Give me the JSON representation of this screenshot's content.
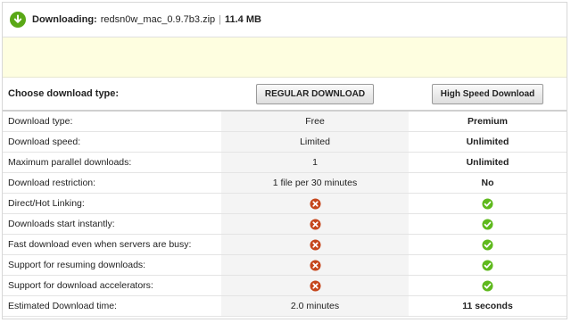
{
  "header": {
    "downloading_label": "Downloading:",
    "filename": "redsn0w_mac_0.9.7b3.zip",
    "separator": "|",
    "size": "11.4 MB",
    "icon": "download-arrow-icon"
  },
  "choose": {
    "label": "Choose download type:",
    "regular_button": "REGULAR DOWNLOAD",
    "premium_button": "High Speed Download"
  },
  "rows": [
    {
      "label": "Download type:",
      "regular": "Free",
      "premium": "Premium"
    },
    {
      "label": "Download speed:",
      "regular": "Limited",
      "premium": "Unlimited"
    },
    {
      "label": "Maximum parallel downloads:",
      "regular": "1",
      "premium": "Unlimited"
    },
    {
      "label": "Download restriction:",
      "regular": "1 file per 30 minutes",
      "premium": "No"
    },
    {
      "label": "Direct/Hot Linking:",
      "regular_icon": "cross-icon",
      "premium_icon": "check-icon"
    },
    {
      "label": "Downloads start instantly:",
      "regular_icon": "cross-icon",
      "premium_icon": "check-icon"
    },
    {
      "label": "Fast download even when servers are busy:",
      "regular_icon": "cross-icon",
      "premium_icon": "check-icon"
    },
    {
      "label": "Support for resuming downloads:",
      "regular_icon": "cross-icon",
      "premium_icon": "check-icon"
    },
    {
      "label": "Support for download accelerators:",
      "regular_icon": "cross-icon",
      "premium_icon": "check-icon"
    },
    {
      "label": "Estimated Download time:",
      "regular": "2.0 minutes",
      "premium": "11 seconds"
    }
  ],
  "colors": {
    "check": "#5fb91d",
    "cross": "#c5461c",
    "download_icon": "#5aa817"
  }
}
